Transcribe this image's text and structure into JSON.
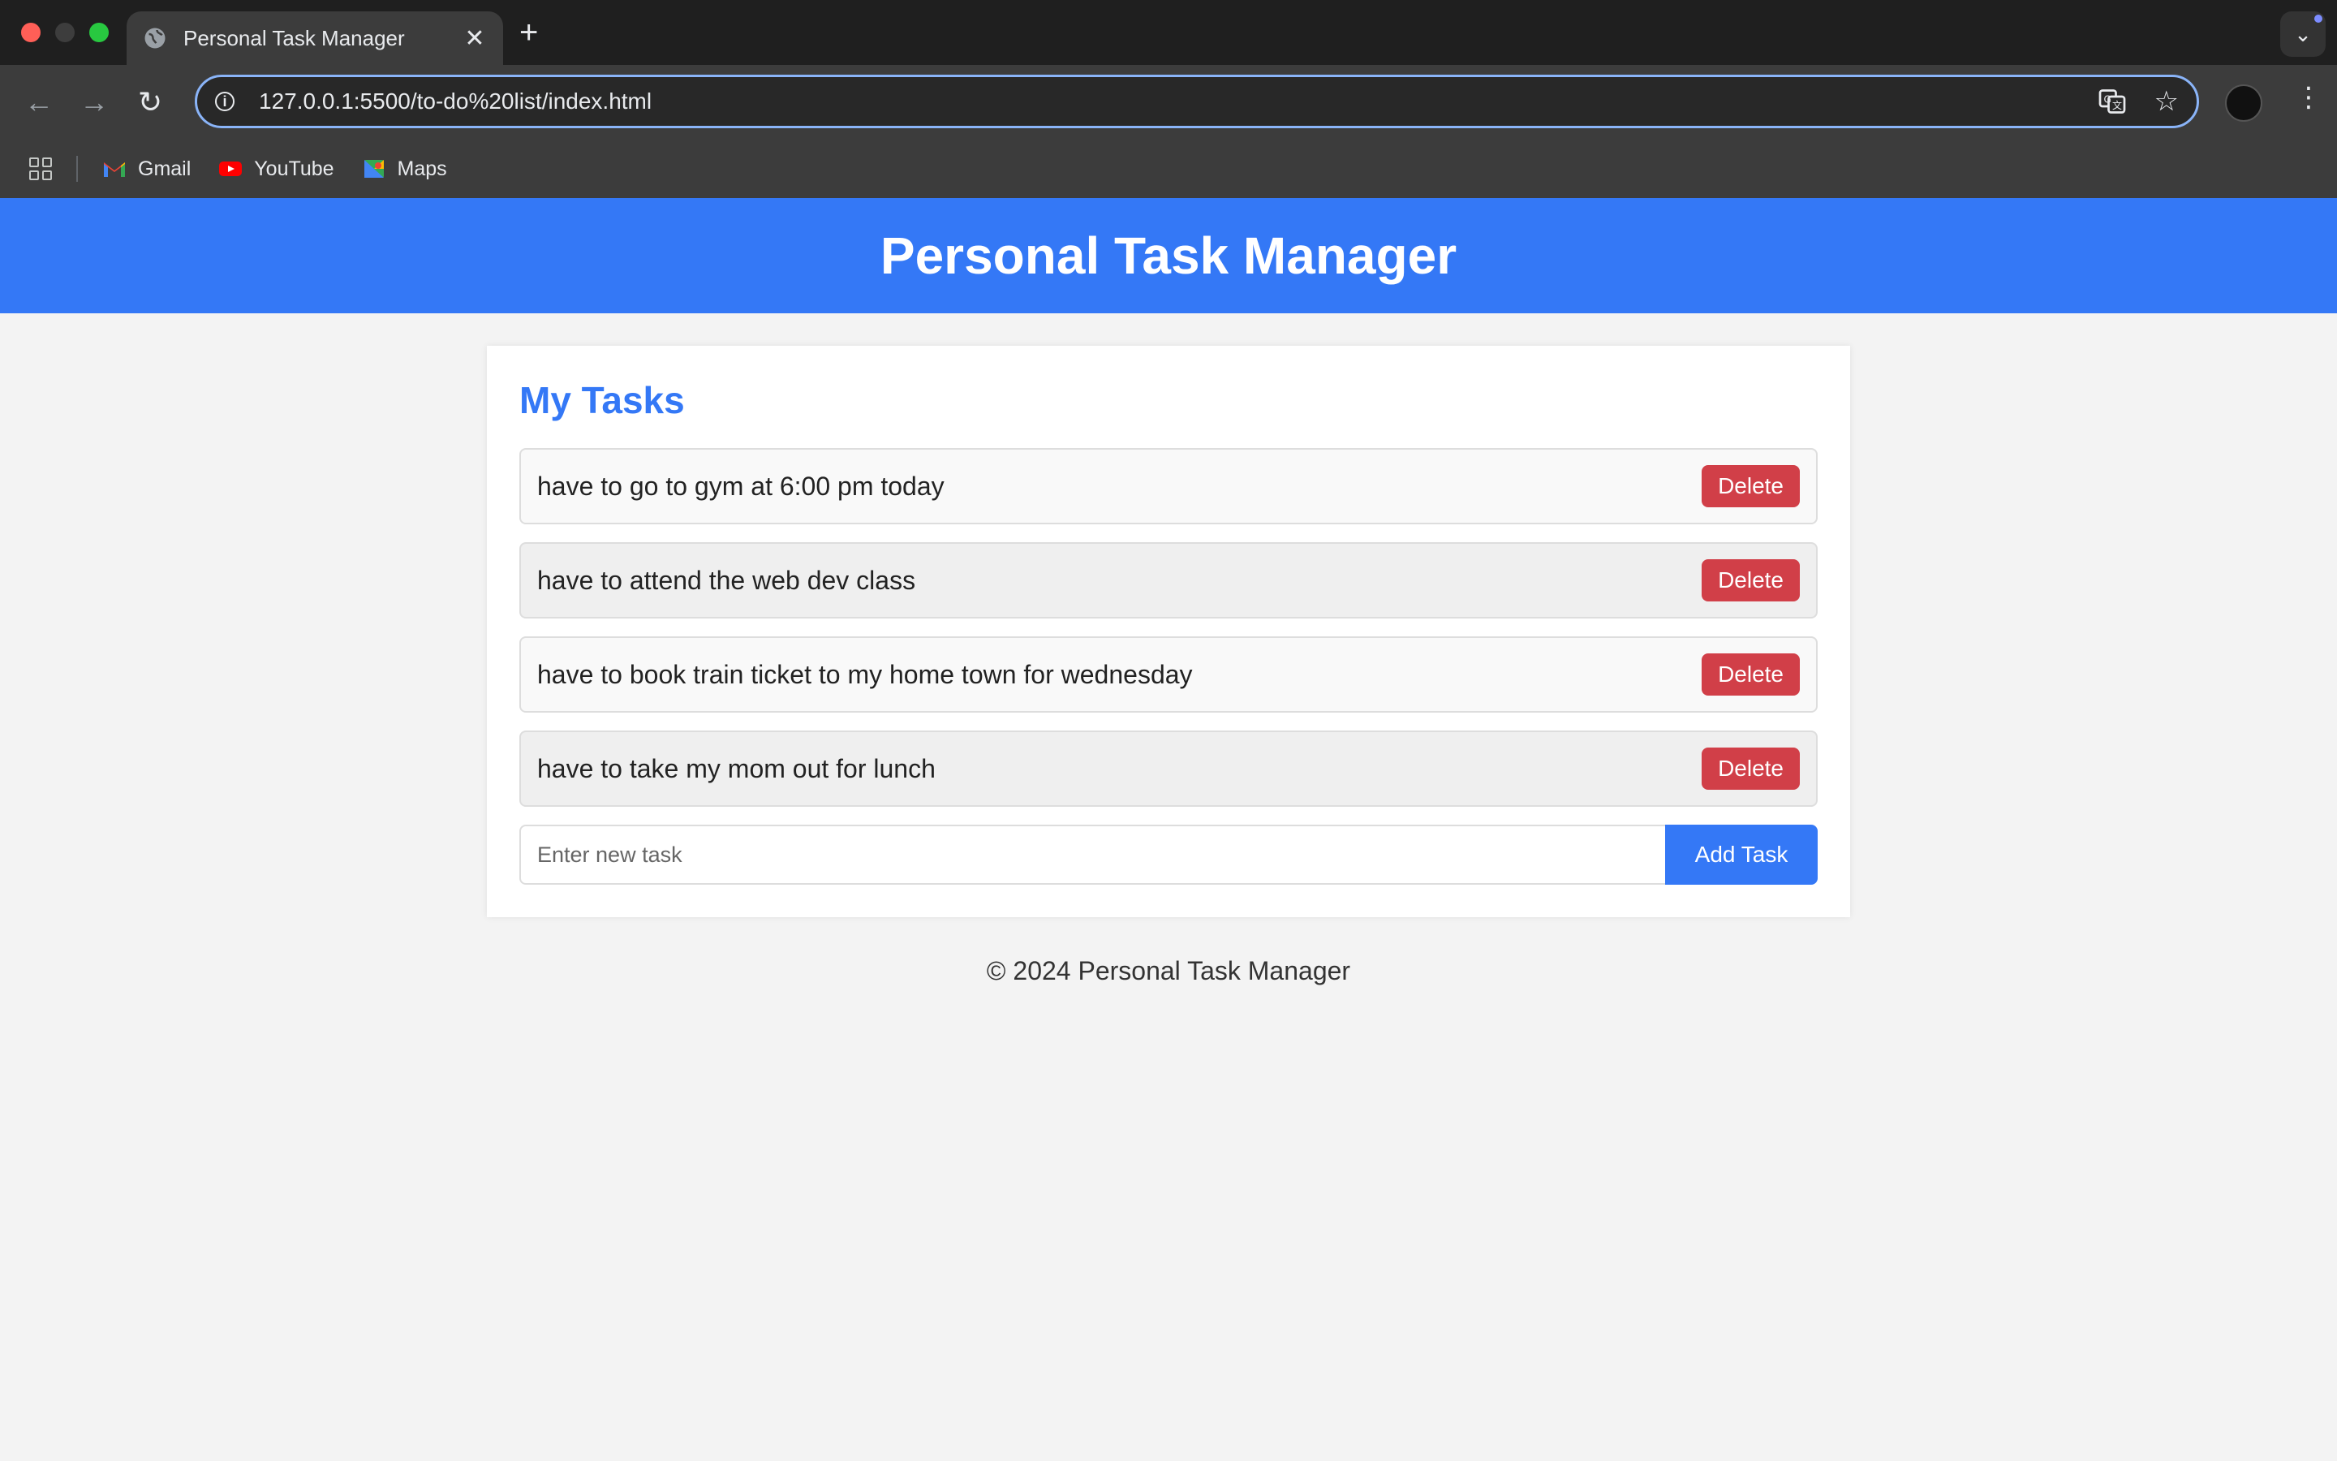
{
  "browser": {
    "tab_title": "Personal Task Manager",
    "tab_close": "✕",
    "new_tab": "+",
    "tab_menu": "⌄",
    "url": "127.0.0.1:5500/to-do%20list/index.html",
    "nav": {
      "back": "←",
      "forward": "→",
      "reload": "↻"
    },
    "omnibox_icons": {
      "translate": "translate-icon",
      "bookmark": "☆"
    },
    "menu": "⋮",
    "bookmarks": [
      {
        "label": "Gmail",
        "icon": "gmail-icon"
      },
      {
        "label": "YouTube",
        "icon": "youtube-icon"
      },
      {
        "label": "Maps",
        "icon": "maps-icon"
      }
    ]
  },
  "app": {
    "header_title": "Personal Task Manager",
    "section_title": "My Tasks",
    "tasks": [
      {
        "text": "have to go to gym at 6:00 pm today",
        "delete_label": "Delete"
      },
      {
        "text": "have to attend the web dev class",
        "delete_label": "Delete"
      },
      {
        "text": "have to book train ticket to my home town for wednesday",
        "delete_label": "Delete"
      },
      {
        "text": "have to take my mom out for lunch",
        "delete_label": "Delete"
      }
    ],
    "new_task_placeholder": "Enter new task",
    "new_task_value": "",
    "add_button_label": "Add Task",
    "footer": "© 2024 Personal Task Manager"
  },
  "colors": {
    "primary": "#3478f6",
    "danger": "#d13f48",
    "page_bg": "#f3f3f3"
  }
}
